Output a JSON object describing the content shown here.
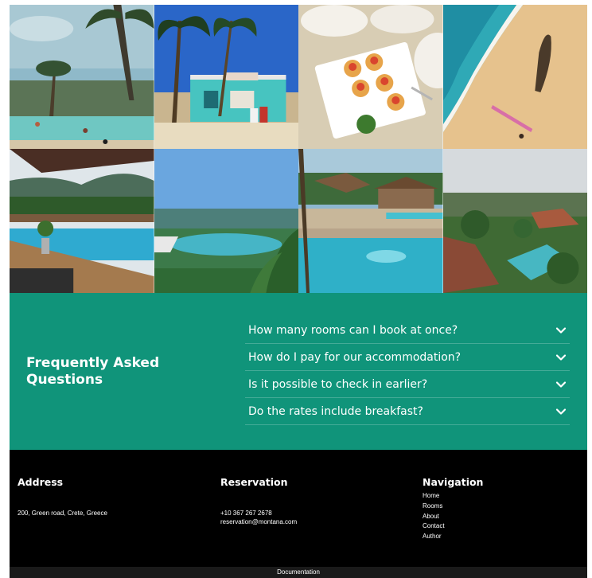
{
  "gallery": {
    "tiles": [
      {
        "name": "resort-pool-palms-photo"
      },
      {
        "name": "beach-shack-photo"
      },
      {
        "name": "appetizer-plate-photo"
      },
      {
        "name": "beach-surfer-aerial-photo"
      },
      {
        "name": "pool-deck-mountains-photo"
      },
      {
        "name": "resort-lagoon-photo"
      },
      {
        "name": "garden-pool-photo"
      },
      {
        "name": "resort-aerial-view-photo"
      }
    ]
  },
  "faq": {
    "title": "Frequently Asked Questions",
    "items": [
      {
        "question": "How many rooms can I book at once?"
      },
      {
        "question": "How do I pay for our accommodation?"
      },
      {
        "question": "Is it possible to check in earlier?"
      },
      {
        "question": "Do the rates include breakfast?"
      }
    ],
    "toggle_icon": "chevron-down-icon",
    "background_color": "#10947a"
  },
  "footer": {
    "address": {
      "heading": "Address",
      "line": "200, Green road, Crete, Greece"
    },
    "reservation": {
      "heading": "Reservation",
      "phone": "+10 367 267 2678",
      "email": "reservation@montana.com"
    },
    "navigation": {
      "heading": "Navigation",
      "links": [
        "Home",
        "Rooms",
        "About",
        "Contact",
        "Author"
      ]
    },
    "bottom_link": "Documentation"
  }
}
